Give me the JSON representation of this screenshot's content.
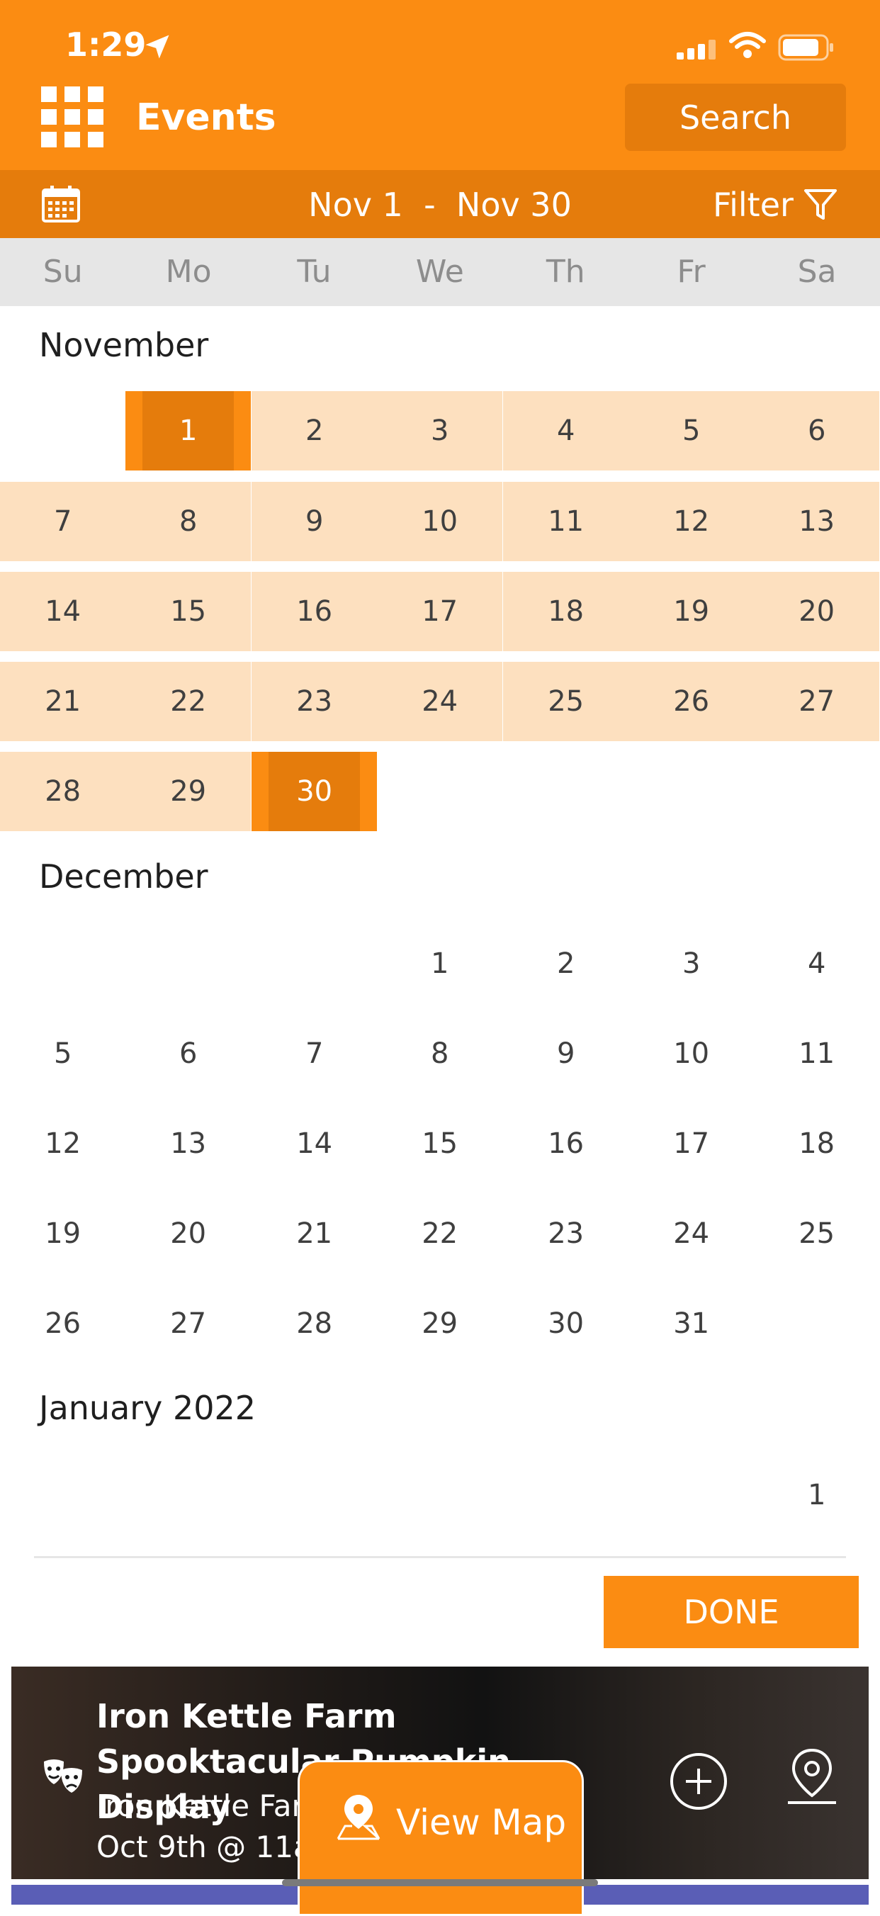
{
  "status": {
    "time": "1:29"
  },
  "header": {
    "title": "Events",
    "search_label": "Search"
  },
  "range": {
    "text": "Nov 1  -  Nov 30",
    "filter_label": "Filter"
  },
  "weekdays": [
    "Su",
    "Mo",
    "Tu",
    "We",
    "Th",
    "Fr",
    "Sa"
  ],
  "months": {
    "november": {
      "title": "November",
      "weeks": [
        [
          "",
          "1",
          "2",
          "3",
          "4",
          "5",
          "6"
        ],
        [
          "7",
          "8",
          "9",
          "10",
          "11",
          "12",
          "13"
        ],
        [
          "14",
          "15",
          "16",
          "17",
          "18",
          "19",
          "20"
        ],
        [
          "21",
          "22",
          "23",
          "24",
          "25",
          "26",
          "27"
        ],
        [
          "28",
          "29",
          "30",
          "",
          "",
          "",
          ""
        ]
      ]
    },
    "december": {
      "title": "December",
      "weeks": [
        [
          "",
          "",
          "",
          "1",
          "2",
          "3",
          "4"
        ],
        [
          "5",
          "6",
          "7",
          "8",
          "9",
          "10",
          "11"
        ],
        [
          "12",
          "13",
          "14",
          "15",
          "16",
          "17",
          "18"
        ],
        [
          "19",
          "20",
          "21",
          "22",
          "23",
          "24",
          "25"
        ],
        [
          "26",
          "27",
          "28",
          "29",
          "30",
          "31",
          ""
        ]
      ]
    },
    "january": {
      "title": "January 2022",
      "weeks": [
        [
          "",
          "",
          "",
          "",
          "",
          "",
          "1"
        ]
      ]
    }
  },
  "selection": {
    "start": "Nov 1",
    "end": "Nov 30"
  },
  "done_label": "DONE",
  "event": {
    "title": "Iron Kettle Farm Spooktacular Pumpkin Display",
    "venue": "Iron Kettle Farr",
    "date": "Oct 9th @ 11ar"
  },
  "view_map_label": "View Map",
  "colors": {
    "primary": "#fb8c12",
    "primary_dark": "#e57c0c",
    "range_fill": "#fde0bf",
    "weekday_bg": "#e6e6e6"
  },
  "icons": [
    "location-arrow-icon",
    "signal-icon",
    "wifi-icon",
    "battery-icon",
    "app-grid-icon",
    "calendar-icon",
    "filter-icon",
    "theater-masks-icon",
    "add-circle-icon",
    "map-pin-icon"
  ]
}
